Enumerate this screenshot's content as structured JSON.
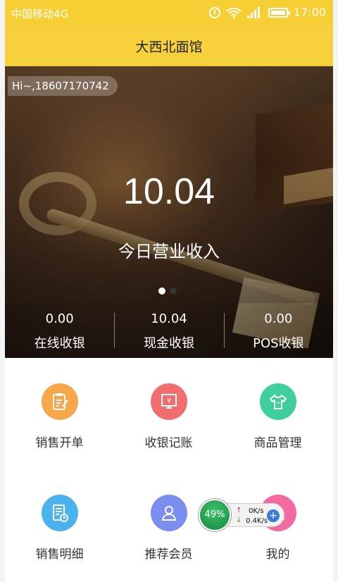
{
  "status_bar": {
    "carrier": "中国移动4G",
    "network_badge": "4G",
    "time": "17:00",
    "icons": [
      "alarm-icon",
      "wifi-icon",
      "signal-icon",
      "battery-icon"
    ]
  },
  "header": {
    "title": "大西北面馆"
  },
  "banner": {
    "greeting": "Hi~,18607170742",
    "amount": "10.04",
    "amount_label": "今日营业收入",
    "pagination": {
      "total": 2,
      "active": 1
    },
    "stats": [
      {
        "value": "0.00",
        "label": "在线收银"
      },
      {
        "value": "10.04",
        "label": "现金收银"
      },
      {
        "value": "0.00",
        "label": "POS收银"
      }
    ]
  },
  "menu": [
    {
      "label": "销售开单",
      "icon": "clipboard-edit-icon",
      "color": "#f7a64a"
    },
    {
      "label": "收银记账",
      "icon": "cashier-screen-icon",
      "color": "#f26d6d"
    },
    {
      "label": "商品管理",
      "icon": "tshirt-icon",
      "color": "#3ecf9a"
    },
    {
      "label": "销售明细",
      "icon": "document-clock-icon",
      "color": "#4ab3ee"
    },
    {
      "label": "推荐会员",
      "icon": "users-icon",
      "color": "#7a8ef0"
    },
    {
      "label": "我的",
      "icon": "user-icon",
      "color": "#f26aa0"
    }
  ],
  "speed_widget": {
    "percent": "49%",
    "upload": "0K/s",
    "download": "0.4K/s"
  },
  "colors": {
    "accent": "#f7d13b"
  }
}
